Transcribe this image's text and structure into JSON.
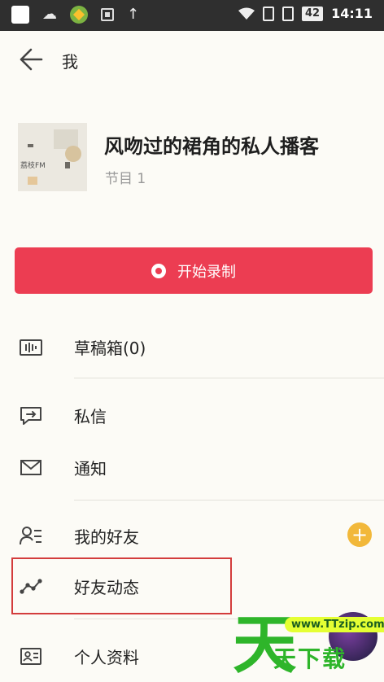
{
  "status_bar": {
    "battery": "42",
    "time": "14:11"
  },
  "header": {
    "title": "我"
  },
  "podcast": {
    "name": "风吻过的裙角的私人播客",
    "episodes": "节目 1",
    "cover_logo_text": "荔枝FM"
  },
  "record_button": {
    "label": "开始录制"
  },
  "menu": {
    "drafts": "草稿箱(0)",
    "messages": "私信",
    "notifications": "通知",
    "friends": "我的好友",
    "friend_activity": "好友动态",
    "profile": "个人资料"
  },
  "friends_add_badge": "+",
  "watermark": {
    "big_char": "天",
    "bubble": "www.TTzip.com",
    "text": "天下载"
  },
  "colors": {
    "status_bar": "#2f2f2f",
    "background": "#fcfbf6",
    "record_button": "#ec3d52",
    "add_badge": "#f2b83a",
    "highlight": "#d33c3c",
    "watermark_green": "#2eb52a"
  },
  "icons": {
    "back": "back-arrow-icon",
    "drafts": "waveform-box-icon",
    "messages": "chat-icon",
    "notifications": "envelope-icon",
    "friends": "friends-list-icon",
    "friend_activity": "activity-line-icon",
    "profile": "id-card-icon"
  }
}
